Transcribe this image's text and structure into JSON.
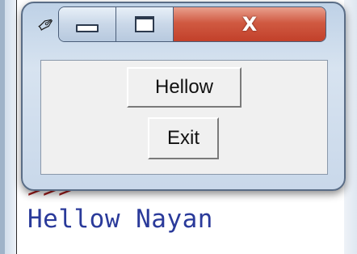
{
  "shell": {
    "prompt": ">>>",
    "output": "Hellow Nayan"
  },
  "window": {
    "app_icon": "feather-icon",
    "controls": {
      "minimize_icon": "minimize-icon",
      "maximize_icon": "maximize-icon",
      "close_glyph": "X"
    },
    "buttons": {
      "hellow_label": "Hellow",
      "exit_label": "Exit"
    }
  },
  "colors": {
    "prompt": "#a01c1c",
    "output": "#2a3a9a",
    "close_button": "#c2402a"
  }
}
